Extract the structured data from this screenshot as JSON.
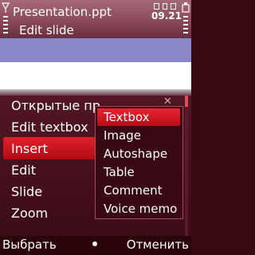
{
  "titlebar": {
    "title": "Presentation.ppt",
    "subtitle": "Edit slide",
    "clock": "09.21"
  },
  "menu": {
    "items": [
      {
        "label": "Открытые пр"
      },
      {
        "label": "Edit textbox"
      },
      {
        "label": "Insert",
        "selected": true
      },
      {
        "label": "Edit"
      },
      {
        "label": "Slide"
      },
      {
        "label": "Zoom"
      }
    ]
  },
  "submenu": {
    "items": [
      {
        "label": "Textbox",
        "selected": true
      },
      {
        "label": "Image"
      },
      {
        "label": "Autoshape"
      },
      {
        "label": "Table"
      },
      {
        "label": "Comment"
      },
      {
        "label": "Voice memo"
      }
    ]
  },
  "softkeys": {
    "left": "Выбрать",
    "right": "Отменить"
  },
  "colors": {
    "accent": "#d11a24",
    "menu_background": "#3c0c18",
    "slide_band": "#8b88c8"
  },
  "icons": [
    "signal-icon",
    "battery-icon",
    "close-icon"
  ]
}
